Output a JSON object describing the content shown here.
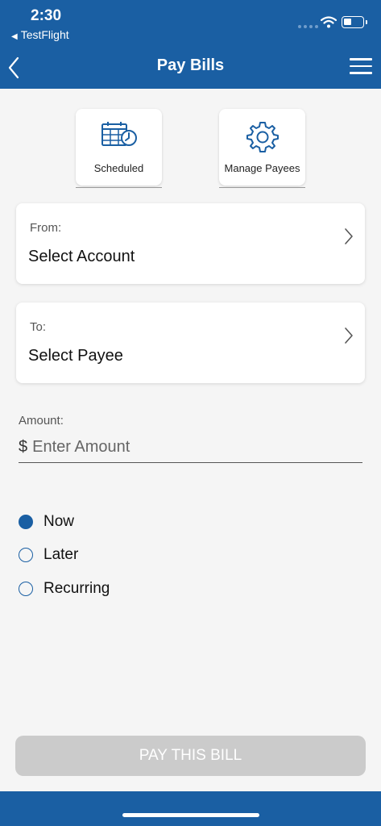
{
  "status_bar": {
    "time": "2:30",
    "back_app": "TestFlight",
    "back_glyph": "◀"
  },
  "header": {
    "title": "Pay Bills",
    "back_icon": "chevron-left-icon",
    "menu_icon": "hamburger-menu-icon"
  },
  "shortcuts": [
    {
      "label": "Scheduled",
      "icon": "calendar-clock-icon"
    },
    {
      "label": "Manage Payees",
      "icon": "gear-icon"
    }
  ],
  "from_card": {
    "label": "From:",
    "value": "Select Account"
  },
  "to_card": {
    "label": "To:",
    "value": "Select Payee"
  },
  "amount": {
    "label": "Amount:",
    "currency": "$",
    "placeholder": "Enter Amount"
  },
  "timing_options": [
    {
      "label": "Now",
      "selected": true
    },
    {
      "label": "Later",
      "selected": false
    },
    {
      "label": "Recurring",
      "selected": false
    }
  ],
  "pay_button": {
    "label": "PAY THIS BILL",
    "enabled": false
  },
  "colors": {
    "brand_blue": "#1a5fa3",
    "disabled_button": "#cbcbcb",
    "background": "#f5f5f5"
  }
}
